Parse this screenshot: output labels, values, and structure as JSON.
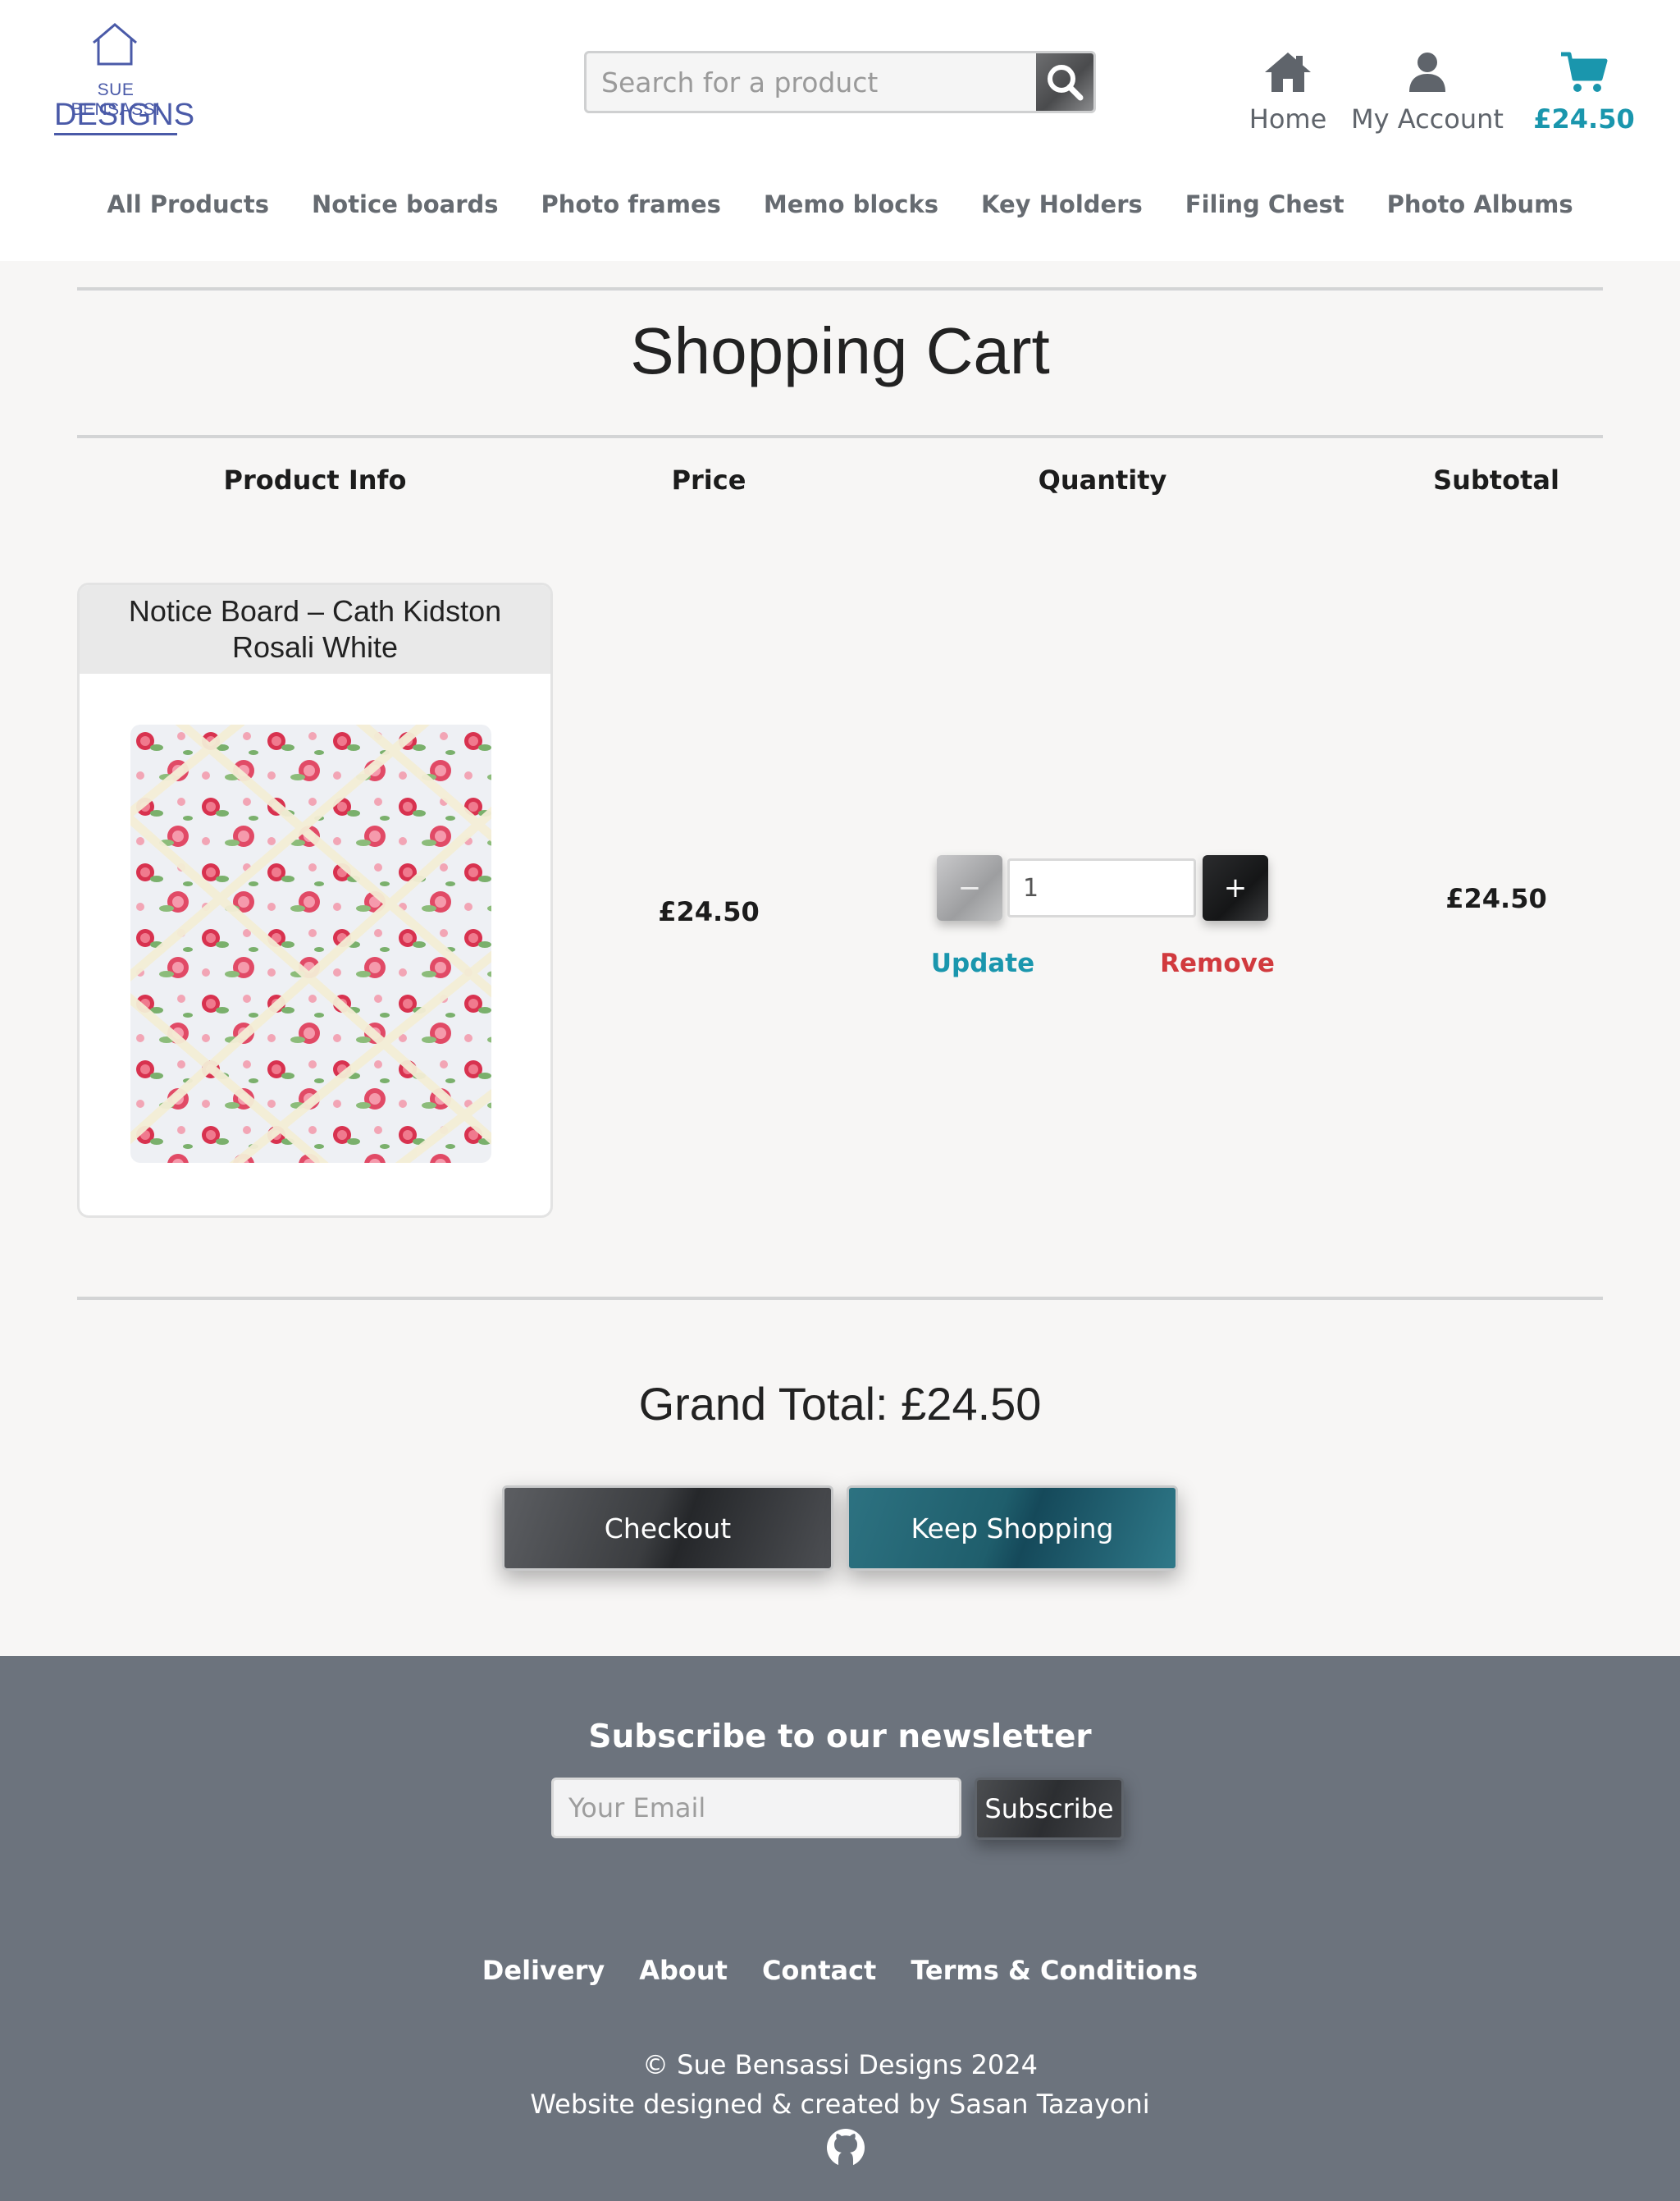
{
  "header": {
    "logo": {
      "top_text": "SUE BENSASSI",
      "main_text": "DESIGNS"
    },
    "search": {
      "placeholder": "Search for a product",
      "icon": "search-icon"
    },
    "nav": {
      "home_label": "Home",
      "account_label": "My Account",
      "cart_total": "£24.50"
    },
    "menu": [
      "All Products",
      "Notice boards",
      "Photo frames",
      "Memo blocks",
      "Key Holders",
      "Filing Chest",
      "Photo Albums"
    ]
  },
  "cart": {
    "title": "Shopping Cart",
    "columns": {
      "product": "Product Info",
      "price": "Price",
      "quantity": "Quantity",
      "subtotal": "Subtotal"
    },
    "items": [
      {
        "name": "Notice Board – Cath Kidston Rosali White",
        "price": "£24.50",
        "quantity": "1",
        "minus_label": "−",
        "plus_label": "+",
        "update_label": "Update",
        "remove_label": "Remove",
        "subtotal": "£24.50"
      }
    ],
    "grand_total": "Grand Total: £24.50",
    "checkout_label": "Checkout",
    "keep_shopping_label": "Keep Shopping"
  },
  "footer": {
    "newsletter_title": "Subscribe to our newsletter",
    "email_placeholder": "Your Email",
    "subscribe_label": "Subscribe",
    "links": [
      "Delivery",
      "About",
      "Contact",
      "Terms & Conditions"
    ],
    "copyright": "© Sue Bensassi Designs 2024",
    "credit": "Website designed & created by Sasan Tazayoni"
  },
  "colors": {
    "accent": "#1a96ad",
    "remove": "#d13a3e",
    "footer_bg": "#6c737d",
    "logo": "#4a5aa8"
  }
}
